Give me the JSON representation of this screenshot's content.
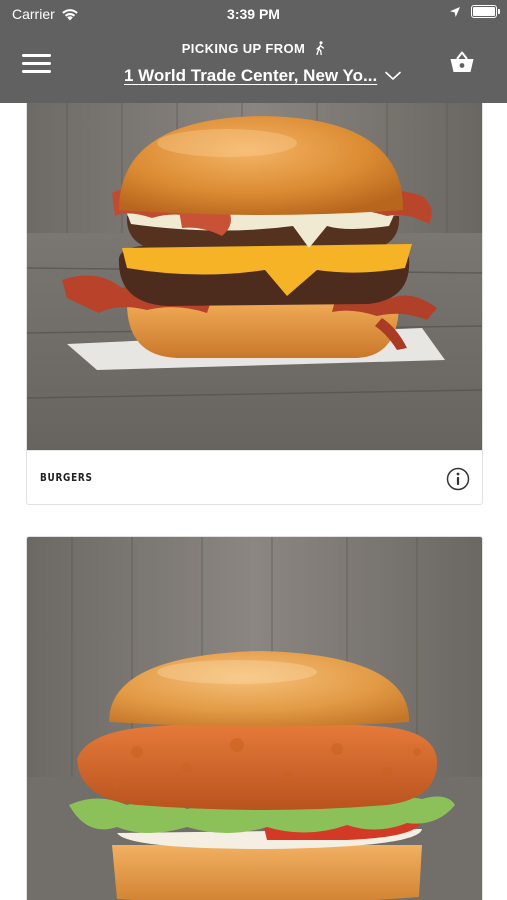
{
  "status_bar": {
    "carrier": "Carrier",
    "time": "3:39 PM"
  },
  "header": {
    "pickup_label": "PICKING UP FROM",
    "location": "1 World Trade Center, New Yo...",
    "icons": [
      "menu-icon",
      "walking-person-icon",
      "chevron-down-icon",
      "basket-icon"
    ]
  },
  "menu": {
    "categories": [
      {
        "label": "BURGERS",
        "image": "bacon-cheeseburger"
      },
      {
        "label": "",
        "image": "crispy-chicken-sandwich"
      }
    ]
  },
  "colors": {
    "header_bg": "#616161",
    "page_bg": "#ffffff",
    "card_border": "#e1e1e1"
  }
}
